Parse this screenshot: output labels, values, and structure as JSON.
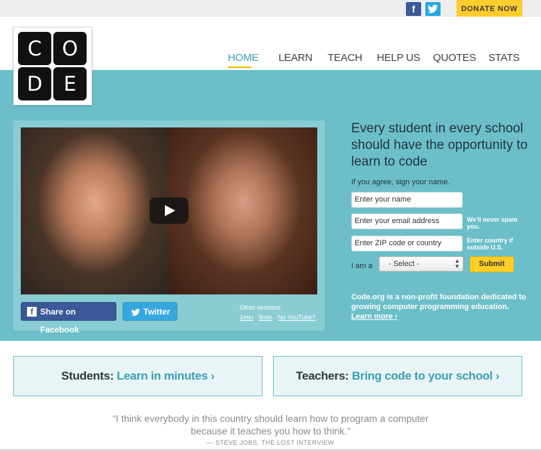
{
  "topbar": {
    "facebook_icon": "f",
    "donate_label": "DONATE NOW"
  },
  "logo": {
    "letters": [
      "C",
      "O",
      "D",
      "E"
    ]
  },
  "nav": {
    "items": [
      {
        "label": "HOME",
        "active": true
      },
      {
        "label": "LEARN",
        "active": false
      },
      {
        "label": "TEACH",
        "active": false
      },
      {
        "label": "HELP US",
        "active": false
      },
      {
        "label": "QUOTES",
        "active": false
      },
      {
        "label": "STATS",
        "active": false
      }
    ]
  },
  "video": {
    "share_facebook": "Share on Facebook",
    "share_twitter": "Twitter",
    "other_versions_label": "Other versions:",
    "versions": [
      "1min",
      "9min",
      "No YouTube?"
    ]
  },
  "signup": {
    "headline": "Every student in every school should have the opportunity to learn to code",
    "prompt": "If you agree, sign your name.",
    "name_placeholder": "Enter your name",
    "email_placeholder": "Enter your email address",
    "email_note": "We'll never spam you.",
    "zip_placeholder": "Enter ZIP code or country",
    "zip_note": "Enter country if outside U.S.",
    "iam_label": "I am a",
    "role_selected": "- Select -",
    "submit_label": "Submit",
    "about": "Code.org is a non-profit foundation dedicated to growing computer programming education.",
    "learn_more": "Learn more ›"
  },
  "cta": {
    "students_prefix": "Students:",
    "students_link": "Learn in minutes ›",
    "teachers_prefix": "Teachers:",
    "teachers_link": "Bring code to your school ›"
  },
  "quote": {
    "line1": "“I think everybody in this country should learn how to program a computer",
    "line2": "because it teaches you how to think.”",
    "attribution": "— STEVE JOBS, THE LOST INTERVIEW"
  },
  "colors": {
    "teal": "#6cbfc9",
    "accent_blue": "#3a9fb3",
    "yellow": "#ffcc2e",
    "facebook": "#3b5998",
    "twitter": "#36a8de"
  }
}
